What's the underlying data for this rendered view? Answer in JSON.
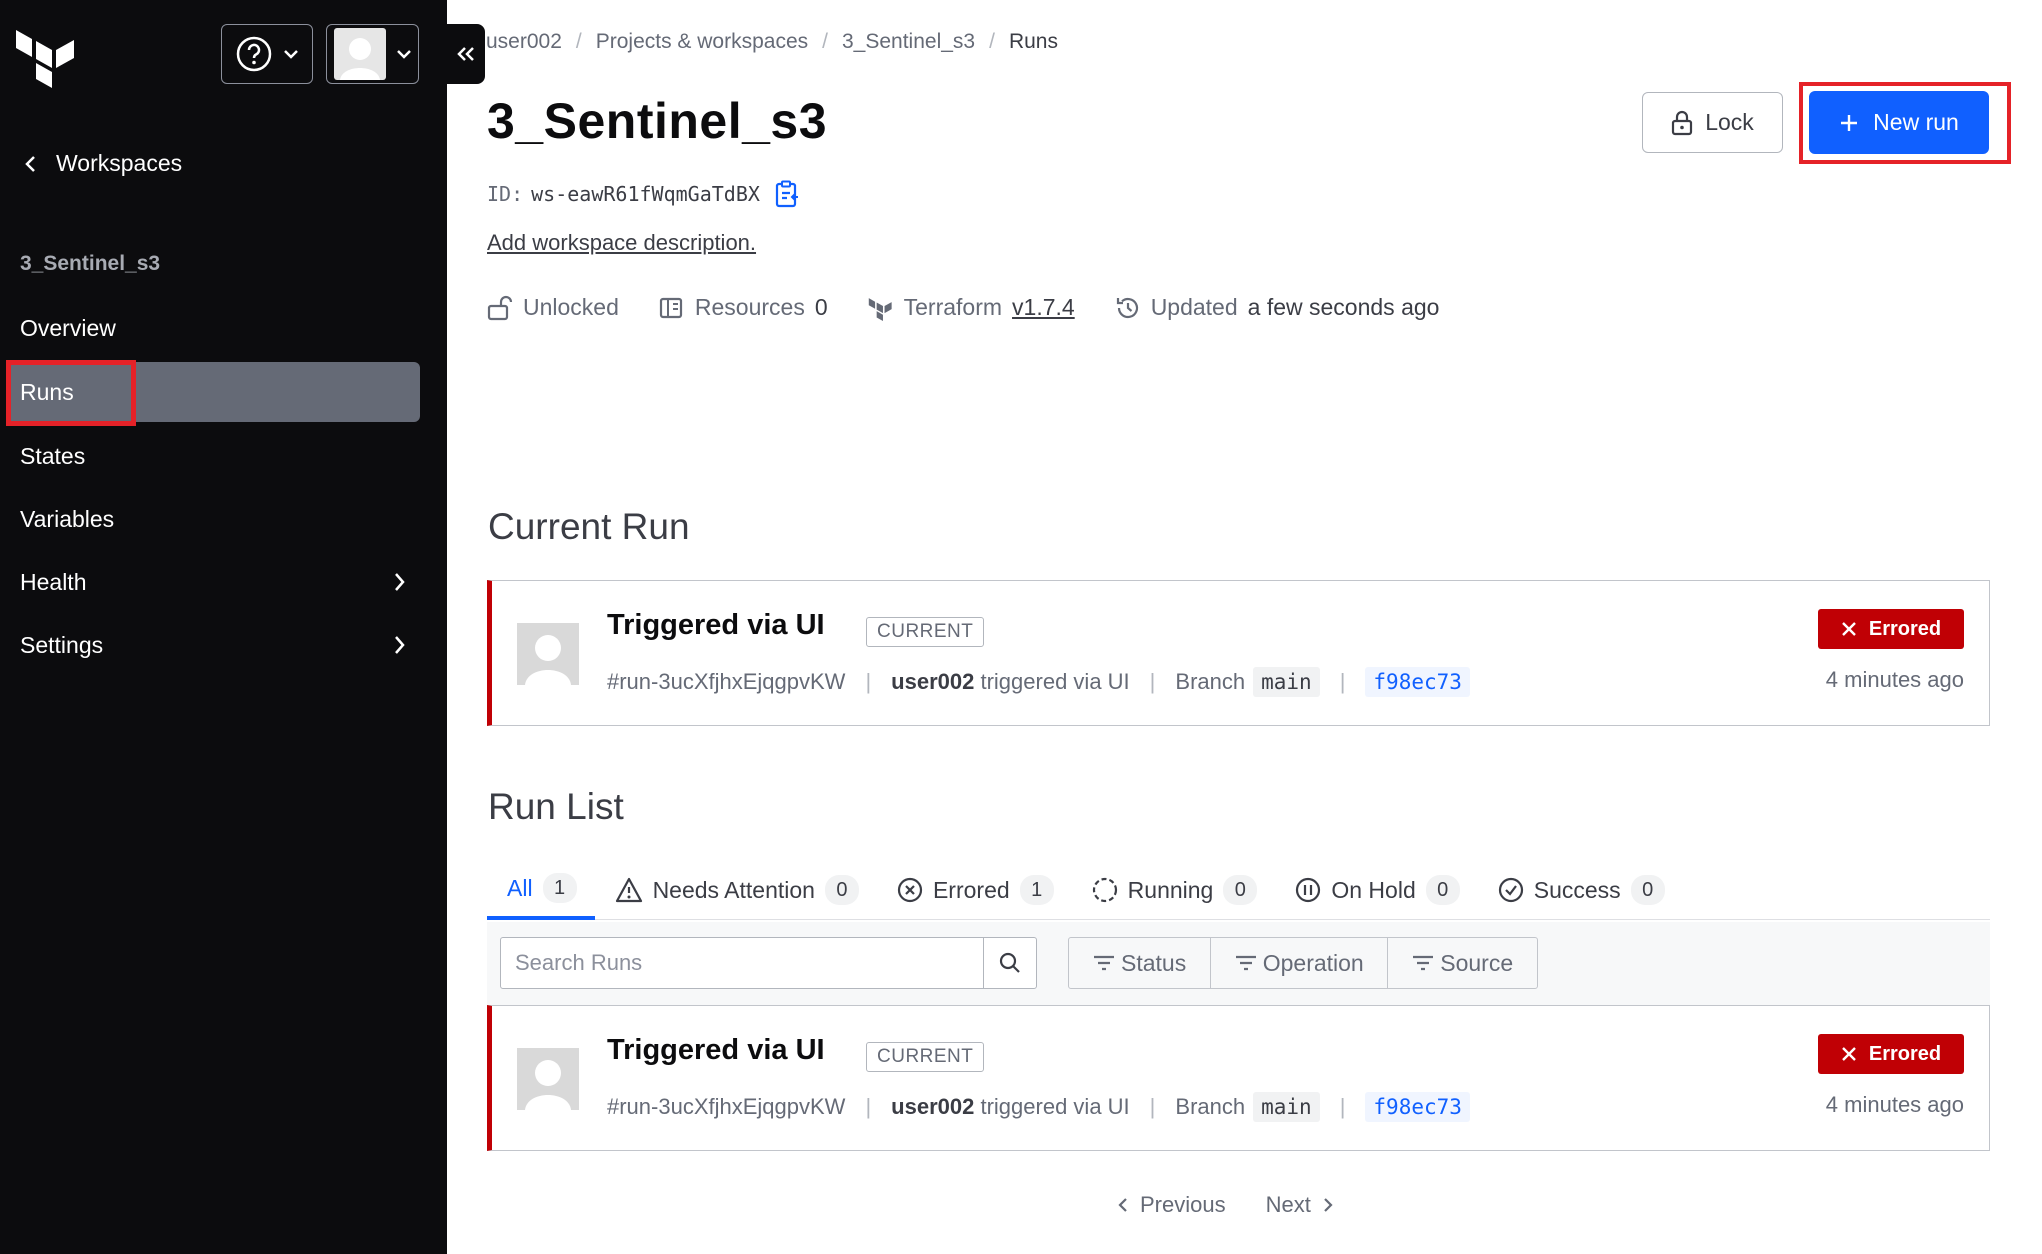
{
  "sidebar": {
    "back_label": "Workspaces",
    "workspace_name": "3_Sentinel_s3",
    "items": [
      {
        "label": "Overview"
      },
      {
        "label": "Runs"
      },
      {
        "label": "States"
      },
      {
        "label": "Variables"
      },
      {
        "label": "Health"
      },
      {
        "label": "Settings"
      }
    ]
  },
  "breadcrumb": [
    "user002",
    "Projects & workspaces",
    "3_Sentinel_s3",
    "Runs"
  ],
  "workspace": {
    "title": "3_Sentinel_s3",
    "id_label": "ID:",
    "id": "ws-eawR61fWqmGaTdBX",
    "description_link": "Add workspace description.",
    "meta": {
      "lock_state": "Unlocked",
      "resources_label": "Resources",
      "resources_count": "0",
      "terraform_label": "Terraform",
      "terraform_version": "v1.7.4",
      "updated_label": "Updated",
      "updated_value": "a few seconds ago"
    }
  },
  "actions": {
    "lock_label": "Lock",
    "new_run_label": "New run"
  },
  "current_run": {
    "heading": "Current Run",
    "title": "Triggered via UI",
    "tag": "CURRENT",
    "run_id": "#run-3ucXfjhxEjqgpvKW",
    "user": "user002",
    "trigger_text": "triggered via UI",
    "branch_label": "Branch",
    "branch": "main",
    "commit": "f98ec73",
    "status": "Errored",
    "time": "4 minutes ago"
  },
  "run_list": {
    "heading": "Run List",
    "tabs": [
      {
        "label": "All",
        "count": "1"
      },
      {
        "label": "Needs Attention",
        "count": "0"
      },
      {
        "label": "Errored",
        "count": "1"
      },
      {
        "label": "Running",
        "count": "0"
      },
      {
        "label": "On Hold",
        "count": "0"
      },
      {
        "label": "Success",
        "count": "0"
      }
    ],
    "search_placeholder": "Search Runs",
    "filters": [
      "Status",
      "Operation",
      "Source"
    ],
    "runs": [
      {
        "title": "Triggered via UI",
        "tag": "CURRENT",
        "run_id": "#run-3ucXfjhxEjqgpvKW",
        "user": "user002",
        "trigger_text": "triggered via UI",
        "branch_label": "Branch",
        "branch": "main",
        "commit": "f98ec73",
        "status": "Errored",
        "time": "4 minutes ago"
      }
    ],
    "pager": {
      "previous": "Previous",
      "next": "Next"
    }
  },
  "colors": {
    "sidebar_bg": "#0c0c0e",
    "accent": "#1060ff",
    "error": "#c00005",
    "highlight": "#e52228"
  }
}
